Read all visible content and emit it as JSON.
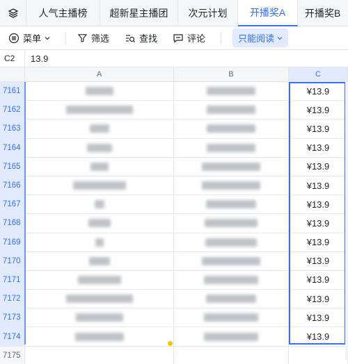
{
  "tabs": [
    {
      "label": "人气主播榜",
      "active": false
    },
    {
      "label": "超新星主播团",
      "active": false
    },
    {
      "label": "次元计划",
      "active": false
    },
    {
      "label": "开播奖A",
      "active": true
    },
    {
      "label": "开播奖B",
      "active": false
    }
  ],
  "toolbar": {
    "menu_label": "菜单",
    "filter_label": "筛选",
    "find_label": "查找",
    "comment_label": "评论",
    "readonly_label": "只能阅读"
  },
  "formula": {
    "cell_ref": "C2",
    "value": "13.9"
  },
  "columns": [
    "A",
    "B",
    "C"
  ],
  "rows": [
    {
      "num": "7161",
      "c": "¥13.9",
      "a_w": 40,
      "b_w": 70
    },
    {
      "num": "7162",
      "c": "¥13.9",
      "a_w": 96,
      "b_w": 70
    },
    {
      "num": "7163",
      "c": "¥13.9",
      "a_w": 28,
      "b_w": 70
    },
    {
      "num": "7164",
      "c": "¥13.9",
      "a_w": 36,
      "b_w": 70
    },
    {
      "num": "7165",
      "c": "¥13.9",
      "a_w": 26,
      "b_w": 84
    },
    {
      "num": "7166",
      "c": "¥13.9",
      "a_w": 76,
      "b_w": 84
    },
    {
      "num": "7167",
      "c": "¥13.9",
      "a_w": 14,
      "b_w": 72
    },
    {
      "num": "7168",
      "c": "¥13.9",
      "a_w": 32,
      "b_w": 76
    },
    {
      "num": "7169",
      "c": "¥13.9",
      "a_w": 12,
      "b_w": 74
    },
    {
      "num": "7170",
      "c": "¥13.9",
      "a_w": 30,
      "b_w": 84
    },
    {
      "num": "7171",
      "c": "¥13.9",
      "a_w": 62,
      "b_w": 78
    },
    {
      "num": "7172",
      "c": "¥13.9",
      "a_w": 96,
      "b_w": 72
    },
    {
      "num": "7173",
      "c": "¥13.9",
      "a_w": 68,
      "b_w": 78
    },
    {
      "num": "7174",
      "c": "¥13.9",
      "a_w": 70,
      "b_w": 78
    },
    {
      "num": "7175",
      "c": "",
      "a_w": 0,
      "b_w": 0
    }
  ]
}
